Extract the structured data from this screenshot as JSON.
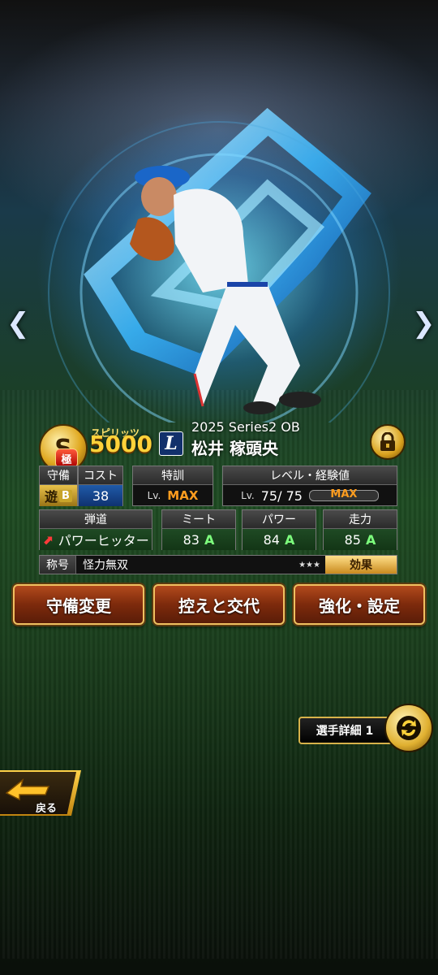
{
  "card": {
    "rank": "S",
    "rank_sub": "極",
    "spirits_label": "スピリッツ",
    "spirits_value": "5000",
    "team_logo": "L",
    "series": "2025 Series2 OB",
    "player_name": "松井 稼頭央"
  },
  "stats": {
    "defense_label": "守備",
    "defense_pos": "遊",
    "defense_grade": "B",
    "cost_label": "コスト",
    "cost_value": "38",
    "special_training_label": "特訓",
    "lv_prefix": "Lv.",
    "special_training_value": "MAX",
    "level_label": "レベル・経験値",
    "level_value": "75/ 75",
    "exp_value": "MAX",
    "trajectory_label": "弾道",
    "trajectory_value": "パワーヒッター",
    "meet_label": "ミート",
    "meet_value": "83",
    "meet_grade": "A",
    "power_label": "パワー",
    "power_value": "84",
    "power_grade": "A",
    "speed_label": "走力",
    "speed_value": "85",
    "speed_grade": "A"
  },
  "title_row": {
    "label": "称号",
    "value": "怪力無双",
    "stars": "★★★",
    "effect_label": "効果"
  },
  "actions": {
    "change_defense": "守備変更",
    "swap_bench": "控えと交代",
    "upgrade_settings": "強化・設定"
  },
  "detail": {
    "label": "選手詳細 1"
  },
  "back": {
    "label": "戻る"
  },
  "colors": {
    "accent_gold": "#f0c060",
    "button_red": "#7d2a0c",
    "grade_green": "#7dff7d",
    "max_orange": "#ff9d1f"
  },
  "icons": [
    "chevron-left-icon",
    "chevron-right-icon",
    "lock-icon",
    "swap-icon",
    "back-arrow-icon"
  ]
}
